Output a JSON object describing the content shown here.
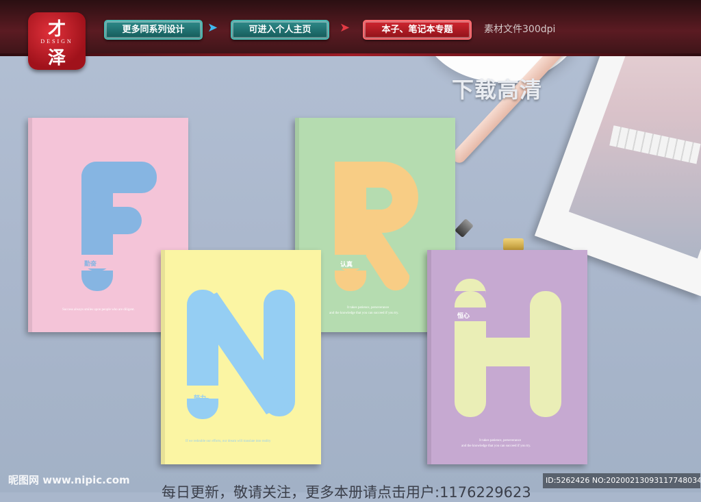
{
  "header": {
    "logo": {
      "char_top": "才",
      "subtitle": "DESIGN",
      "char_bottom": "泽"
    },
    "buttons": [
      {
        "label": "更多同系列设计",
        "style": "teal"
      },
      {
        "label": "可进入个人主页",
        "style": "teal"
      },
      {
        "label": "本子、笔记本专题",
        "style": "red"
      }
    ],
    "arrow": "➤",
    "resolution": "素材文件300dpi"
  },
  "download_label": "下载高清",
  "notebooks": [
    {
      "letter": "F",
      "word": "勤奋",
      "quote": "Success always smiles upon people who are diligent.",
      "quote2": "",
      "bg": "#f4c4d8",
      "fg": "#86b5e2",
      "wordcolor": "#86b5e2",
      "quotecolor": "#ffffff"
    },
    {
      "letter": "R",
      "word": "认真",
      "quote": "It takes patience, perseverance",
      "quote2": "and the knowledge that you can succeed if you try.",
      "bg": "#b5dcb0",
      "fg": "#f8cd85",
      "wordcolor": "#ffffff",
      "quotecolor": "#ffffff"
    },
    {
      "letter": "N",
      "word": "努力",
      "quote": "If we redouble our efforts, our dream will translate into reality",
      "quote2": "",
      "bg": "#fbf5a3",
      "fg": "#95cef3",
      "wordcolor": "#95cef3",
      "quotecolor": "#95cef3"
    },
    {
      "letter": "H",
      "word": "恒心",
      "quote": "It takes patience, perseverance",
      "quote2": "and the knowledge that you can succeed if you try.",
      "bg": "#c6a9d1",
      "fg": "#eaeeb6",
      "wordcolor": "#ffffff",
      "quotecolor": "#ffffff"
    }
  ],
  "footer": {
    "watermark": "昵图网 www.nipic.com",
    "id_text": "ID:5262426 NO:20200213093117748034",
    "notice": "每日更新，敬请关注，更多本册请点击用户:1176229623"
  }
}
